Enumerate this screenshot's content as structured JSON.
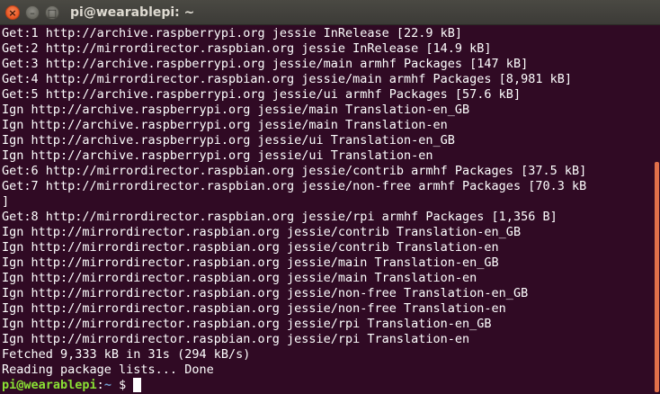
{
  "window": {
    "title": "pi@wearablepi: ~",
    "close_glyph": "×",
    "minimize_glyph": "–",
    "maximize_glyph": "□"
  },
  "terminal": {
    "lines": [
      "Get:1 http://archive.raspberrypi.org jessie InRelease [22.9 kB]",
      "Get:2 http://mirrordirector.raspbian.org jessie InRelease [14.9 kB]",
      "Get:3 http://archive.raspberrypi.org jessie/main armhf Packages [147 kB]",
      "Get:4 http://mirrordirector.raspbian.org jessie/main armhf Packages [8,981 kB]",
      "Get:5 http://archive.raspberrypi.org jessie/ui armhf Packages [57.6 kB]",
      "Ign http://archive.raspberrypi.org jessie/main Translation-en_GB",
      "Ign http://archive.raspberrypi.org jessie/main Translation-en",
      "Ign http://archive.raspberrypi.org jessie/ui Translation-en_GB",
      "Ign http://archive.raspberrypi.org jessie/ui Translation-en",
      "Get:6 http://mirrordirector.raspbian.org jessie/contrib armhf Packages [37.5 kB]",
      "Get:7 http://mirrordirector.raspbian.org jessie/non-free armhf Packages [70.3 kB",
      "]",
      "Get:8 http://mirrordirector.raspbian.org jessie/rpi armhf Packages [1,356 B]",
      "Ign http://mirrordirector.raspbian.org jessie/contrib Translation-en_GB",
      "Ign http://mirrordirector.raspbian.org jessie/contrib Translation-en",
      "Ign http://mirrordirector.raspbian.org jessie/main Translation-en_GB",
      "Ign http://mirrordirector.raspbian.org jessie/main Translation-en",
      "Ign http://mirrordirector.raspbian.org jessie/non-free Translation-en_GB",
      "Ign http://mirrordirector.raspbian.org jessie/non-free Translation-en",
      "Ign http://mirrordirector.raspbian.org jessie/rpi Translation-en_GB",
      "Ign http://mirrordirector.raspbian.org jessie/rpi Translation-en",
      "Fetched 9,333 kB in 31s (294 kB/s)",
      "Reading package lists... Done"
    ],
    "prompt": {
      "user_host": "pi@wearablepi",
      "separator": ":",
      "path": "~",
      "symbol": " $ "
    }
  },
  "colors": {
    "background": "#300a24",
    "prompt_user": "#8ae234",
    "prompt_path": "#729fcf",
    "close_button": "#e95420",
    "scrollbar": "#e0704a"
  }
}
